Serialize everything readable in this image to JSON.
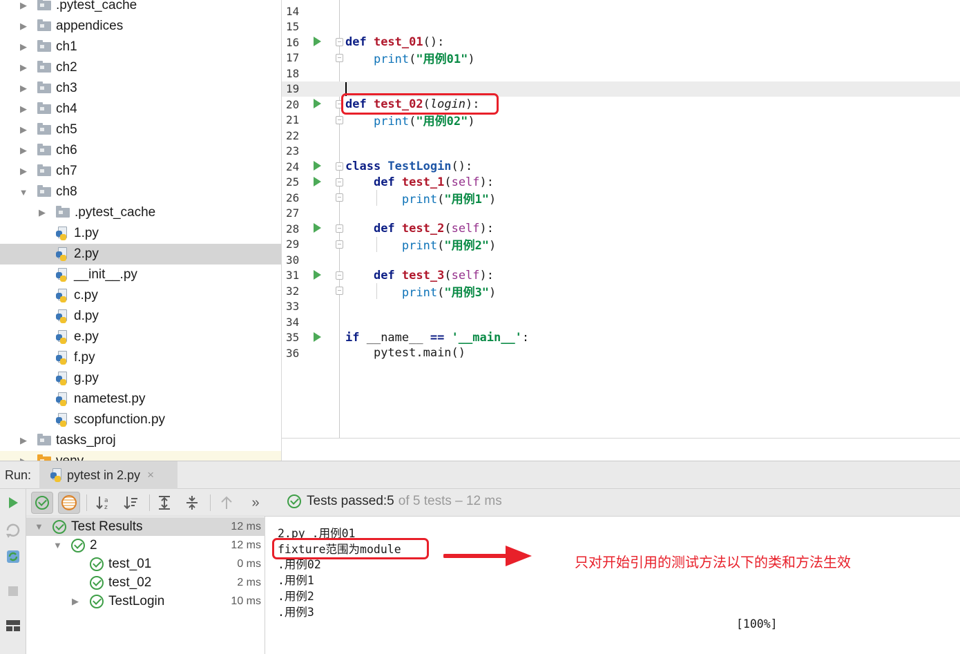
{
  "project_tree": [
    {
      "label": ".pytest_cache",
      "type": "folder",
      "expand": "collapsed",
      "depth": 0
    },
    {
      "label": "appendices",
      "type": "folder",
      "expand": "collapsed",
      "depth": 0
    },
    {
      "label": "ch1",
      "type": "folder",
      "expand": "collapsed",
      "depth": 0
    },
    {
      "label": "ch2",
      "type": "folder",
      "expand": "collapsed",
      "depth": 0
    },
    {
      "label": "ch3",
      "type": "folder",
      "expand": "collapsed",
      "depth": 0
    },
    {
      "label": "ch4",
      "type": "folder",
      "expand": "collapsed",
      "depth": 0
    },
    {
      "label": "ch5",
      "type": "folder",
      "expand": "collapsed",
      "depth": 0
    },
    {
      "label": "ch6",
      "type": "folder",
      "expand": "collapsed",
      "depth": 0
    },
    {
      "label": "ch7",
      "type": "folder",
      "expand": "collapsed",
      "depth": 0
    },
    {
      "label": "ch8",
      "type": "folder",
      "expand": "expanded",
      "depth": 0
    },
    {
      "label": ".pytest_cache",
      "type": "folder",
      "expand": "collapsed",
      "depth": 1
    },
    {
      "label": "1.py",
      "type": "python-file",
      "expand": "none",
      "depth": 1
    },
    {
      "label": "2.py",
      "type": "python-file",
      "expand": "none",
      "depth": 1,
      "selected": true
    },
    {
      "label": "__init__.py",
      "type": "python-file",
      "expand": "none",
      "depth": 1
    },
    {
      "label": "c.py",
      "type": "python-file",
      "expand": "none",
      "depth": 1
    },
    {
      "label": "d.py",
      "type": "python-file",
      "expand": "none",
      "depth": 1
    },
    {
      "label": "e.py",
      "type": "python-file",
      "expand": "none",
      "depth": 1
    },
    {
      "label": "f.py",
      "type": "python-file",
      "expand": "none",
      "depth": 1
    },
    {
      "label": "g.py",
      "type": "python-file",
      "expand": "none",
      "depth": 1
    },
    {
      "label": "nametest.py",
      "type": "python-file",
      "expand": "none",
      "depth": 1
    },
    {
      "label": "scopfunction.py",
      "type": "python-file",
      "expand": "none",
      "depth": 1
    },
    {
      "label": "tasks_proj",
      "type": "folder",
      "expand": "collapsed",
      "depth": 0
    },
    {
      "label": "venv",
      "type": "venv-folder",
      "expand": "collapsed",
      "depth": 0
    }
  ],
  "editor": {
    "lines": [
      {
        "num": "14",
        "tokens": []
      },
      {
        "num": "15",
        "tokens": []
      },
      {
        "num": "16",
        "run": true,
        "fold": true,
        "tokens": [
          {
            "t": "def ",
            "c": "kw"
          },
          {
            "t": "test_01",
            "c": "fn"
          },
          {
            "t": "():",
            "c": "plain"
          }
        ]
      },
      {
        "num": "17",
        "fold": true,
        "tokens": [
          {
            "t": "    ",
            "c": "plain"
          },
          {
            "t": "print",
            "c": "builtin"
          },
          {
            "t": "(",
            "c": "plain"
          },
          {
            "t": "\"用例01\"",
            "c": "str"
          },
          {
            "t": ")",
            "c": "plain"
          }
        ]
      },
      {
        "num": "18",
        "tokens": []
      },
      {
        "num": "19",
        "current": true,
        "caret": true,
        "tokens": []
      },
      {
        "num": "20",
        "run": true,
        "fold": true,
        "tokens": [
          {
            "t": "def ",
            "c": "kw"
          },
          {
            "t": "test_02",
            "c": "fn"
          },
          {
            "t": "(",
            "c": "plain"
          },
          {
            "t": "login",
            "c": "param"
          },
          {
            "t": "):",
            "c": "plain"
          }
        ]
      },
      {
        "num": "21",
        "fold": true,
        "tokens": [
          {
            "t": "    ",
            "c": "plain"
          },
          {
            "t": "print",
            "c": "builtin"
          },
          {
            "t": "(",
            "c": "plain"
          },
          {
            "t": "\"用例02\"",
            "c": "str"
          },
          {
            "t": ")",
            "c": "plain"
          }
        ]
      },
      {
        "num": "22",
        "tokens": []
      },
      {
        "num": "23",
        "tokens": []
      },
      {
        "num": "24",
        "run": true,
        "fold": true,
        "tokens": [
          {
            "t": "class ",
            "c": "kw"
          },
          {
            "t": "TestLogin",
            "c": "cls"
          },
          {
            "t": "():",
            "c": "plain"
          }
        ]
      },
      {
        "num": "25",
        "run": true,
        "fold": true,
        "tokens": [
          {
            "t": "    ",
            "c": "plain"
          },
          {
            "t": "def ",
            "c": "kw"
          },
          {
            "t": "test_1",
            "c": "fn"
          },
          {
            "t": "(",
            "c": "plain"
          },
          {
            "t": "self",
            "c": "self"
          },
          {
            "t": "):",
            "c": "plain"
          }
        ]
      },
      {
        "num": "26",
        "fold": true,
        "guide": true,
        "tokens": [
          {
            "t": "        ",
            "c": "plain"
          },
          {
            "t": "print",
            "c": "builtin"
          },
          {
            "t": "(",
            "c": "plain"
          },
          {
            "t": "\"用例1\"",
            "c": "str"
          },
          {
            "t": ")",
            "c": "plain"
          }
        ]
      },
      {
        "num": "27",
        "tokens": []
      },
      {
        "num": "28",
        "run": true,
        "fold": true,
        "tokens": [
          {
            "t": "    ",
            "c": "plain"
          },
          {
            "t": "def ",
            "c": "kw"
          },
          {
            "t": "test_2",
            "c": "fn"
          },
          {
            "t": "(",
            "c": "plain"
          },
          {
            "t": "self",
            "c": "self"
          },
          {
            "t": "):",
            "c": "plain"
          }
        ]
      },
      {
        "num": "29",
        "fold": true,
        "guide": true,
        "tokens": [
          {
            "t": "        ",
            "c": "plain"
          },
          {
            "t": "print",
            "c": "builtin"
          },
          {
            "t": "(",
            "c": "plain"
          },
          {
            "t": "\"用例2\"",
            "c": "str"
          },
          {
            "t": ")",
            "c": "plain"
          }
        ]
      },
      {
        "num": "30",
        "tokens": []
      },
      {
        "num": "31",
        "run": true,
        "fold": true,
        "tokens": [
          {
            "t": "    ",
            "c": "plain"
          },
          {
            "t": "def ",
            "c": "kw"
          },
          {
            "t": "test_3",
            "c": "fn"
          },
          {
            "t": "(",
            "c": "plain"
          },
          {
            "t": "self",
            "c": "self"
          },
          {
            "t": "):",
            "c": "plain"
          }
        ]
      },
      {
        "num": "32",
        "fold": true,
        "guide": true,
        "tokens": [
          {
            "t": "        ",
            "c": "plain"
          },
          {
            "t": "print",
            "c": "builtin"
          },
          {
            "t": "(",
            "c": "plain"
          },
          {
            "t": "\"用例3\"",
            "c": "str"
          },
          {
            "t": ")",
            "c": "plain"
          }
        ]
      },
      {
        "num": "33",
        "tokens": []
      },
      {
        "num": "34",
        "tokens": []
      },
      {
        "num": "35",
        "run": true,
        "tokens": [
          {
            "t": "if ",
            "c": "kw"
          },
          {
            "t": "__name__ ",
            "c": "plain"
          },
          {
            "t": "== ",
            "c": "kw"
          },
          {
            "t": "'__main__'",
            "c": "str"
          },
          {
            "t": ":",
            "c": "plain"
          }
        ]
      },
      {
        "num": "36",
        "tokens": [
          {
            "t": "    ",
            "c": "plain"
          },
          {
            "t": "pytest.main()",
            "c": "plain"
          }
        ]
      }
    ]
  },
  "run_panel": {
    "run_label": "Run:",
    "tab_title": "pytest in 2.py",
    "tab_close": "×",
    "status": {
      "prefix": "Tests passed: ",
      "passed": "5",
      "rest": "of 5 tests – 12 ms"
    },
    "results": [
      {
        "label": "Test Results",
        "time": "12 ms",
        "depth": 0,
        "expand": "expanded",
        "root": true
      },
      {
        "label": "2",
        "time": "12 ms",
        "depth": 1,
        "expand": "expanded"
      },
      {
        "label": "test_01",
        "time": "0 ms",
        "depth": 2,
        "expand": "none"
      },
      {
        "label": "test_02",
        "time": "2 ms",
        "depth": 2,
        "expand": "none"
      },
      {
        "label": "TestLogin",
        "time": "10 ms",
        "depth": 2,
        "expand": "collapsed"
      }
    ],
    "console": {
      "lines": [
        "2.py .用例01",
        "fixture范围为module",
        ".用例02",
        ".用例1",
        ".用例2",
        ".用例3"
      ],
      "percent": "[100%]"
    },
    "annotation": "只对开始引用的测试方法以下的类和方法生效"
  },
  "colors": {
    "accent_red": "#e8202a",
    "pass_green": "#3f9f48",
    "run_green": "#4caa57"
  }
}
